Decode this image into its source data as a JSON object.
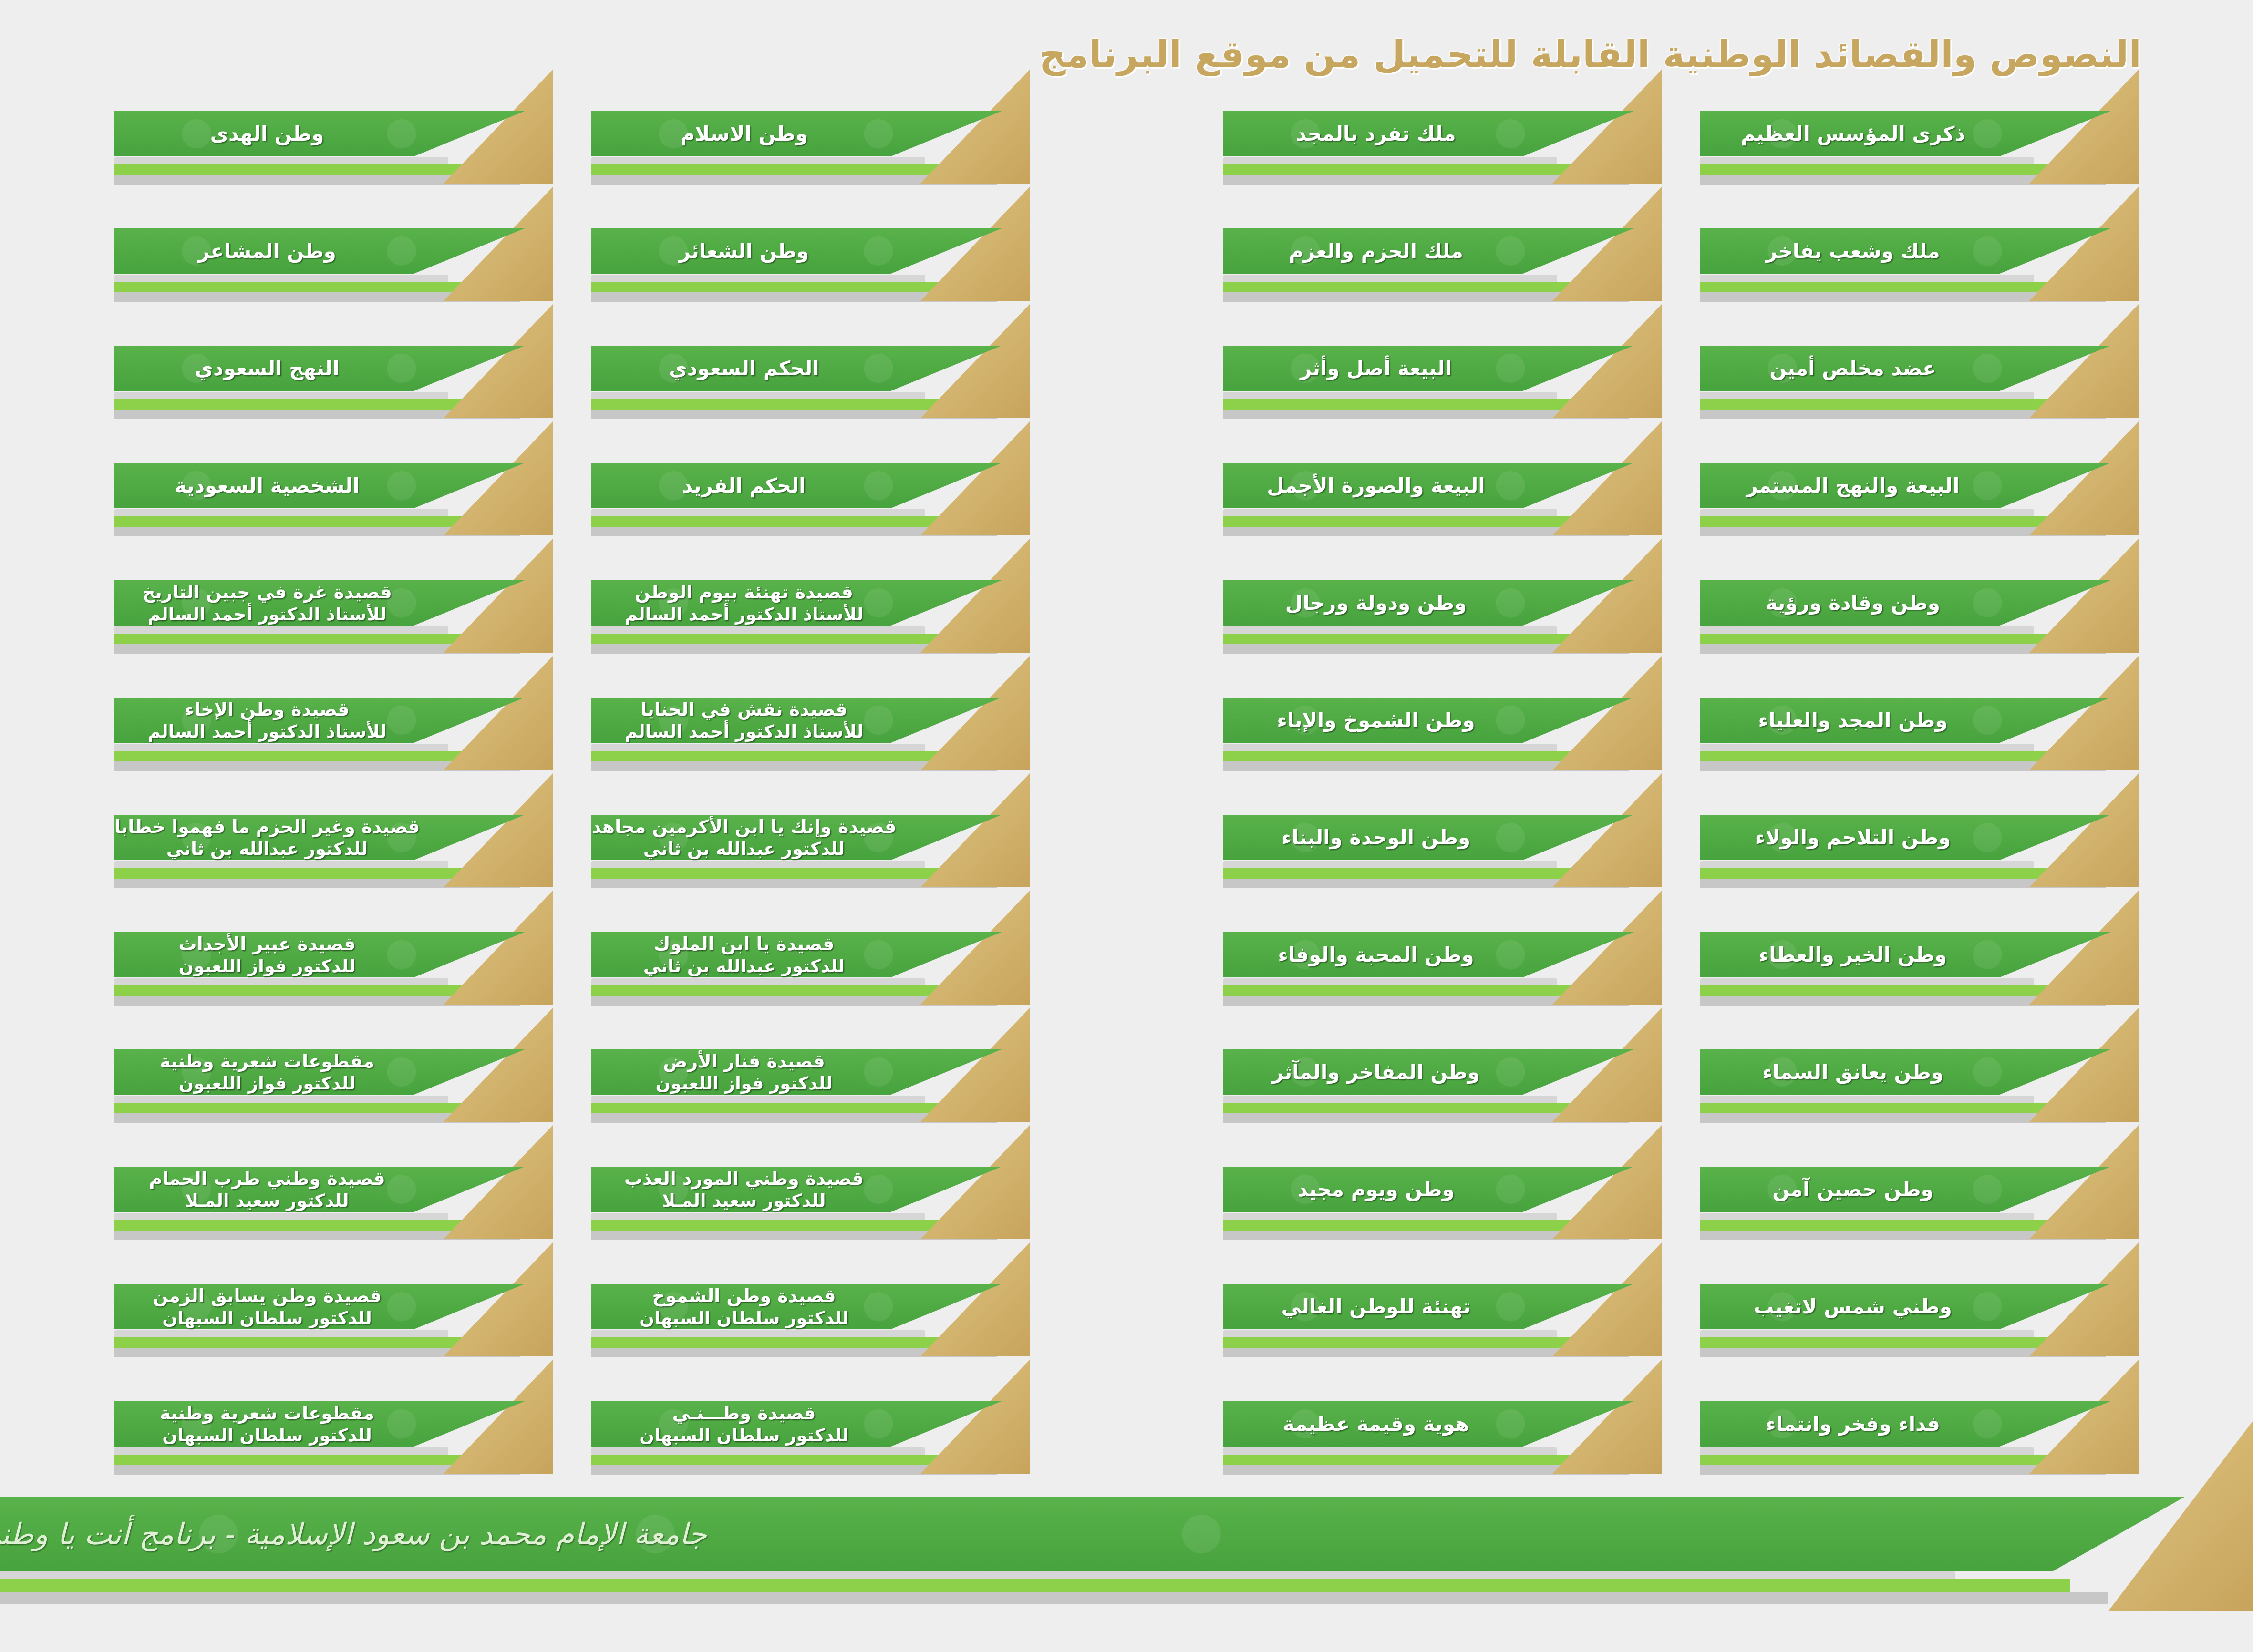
{
  "title": "النصوص والقصائد الوطنية القابلة للتحميل من موقع البرنامج",
  "colors": {
    "green": "#4caa41",
    "gold": "#d0b06a",
    "light_green": "#8dd14a",
    "grey": "#c7c7c7"
  },
  "columns": [
    {
      "items": [
        {
          "line1": "ذكرى المؤسس العظيم"
        },
        {
          "line1": "ملك وشعب يفاخر"
        },
        {
          "line1": "عضد مخلص أمين"
        },
        {
          "line1": "البيعة والنهج المستمر"
        },
        {
          "line1": "وطن وقادة ورؤية"
        },
        {
          "line1": "وطن المجد والعلياء"
        },
        {
          "line1": "وطن التلاحم والولاء"
        },
        {
          "line1": "وطن الخير والعطاء"
        },
        {
          "line1": "وطن يعانق السماء"
        },
        {
          "line1": "وطن حصين آمن"
        },
        {
          "line1": "وطني شمس لاتغيب"
        },
        {
          "line1": "فداء وفخر وانتماء"
        }
      ]
    },
    {
      "items": [
        {
          "line1": "ملك تفرد بالمجد"
        },
        {
          "line1": "ملك الحزم والعزم"
        },
        {
          "line1": "البيعة أصل وأثر"
        },
        {
          "line1": "البيعة والصورة الأجمل"
        },
        {
          "line1": "وطن ودولة ورجال"
        },
        {
          "line1": "وطن الشموخ والإباء"
        },
        {
          "line1": "وطن الوحدة والبناء"
        },
        {
          "line1": "وطن المحبة والوفاء"
        },
        {
          "line1": "وطن المفاخر والمآثر"
        },
        {
          "line1": "وطن ويوم مجيد"
        },
        {
          "line1": "تهنئة للوطن الغالي"
        },
        {
          "line1": "هوية وقيمة عظيمة"
        }
      ]
    },
    {
      "items": [
        {
          "line1": "وطن الاسلام"
        },
        {
          "line1": "وطن الشعائر"
        },
        {
          "line1": "الحكم السعودي"
        },
        {
          "line1": "الحكم الفريد"
        },
        {
          "line1": "قصيدة تهنئة بيوم الوطن",
          "line2": "للأستاذ الدكتور أحمد السالم"
        },
        {
          "line1": "قصيدة نقش في الحنايا",
          "line2": "للأستاذ الدكتور أحمد السالم"
        },
        {
          "line1": "قصيدة وإنك يا ابن الأكرمين مجاهد",
          "line2": "للدكتور عبدالله بن ثاني"
        },
        {
          "line1": "قصيدة يا ابن الملوك",
          "line2": "للدكتور عبدالله بن ثاني"
        },
        {
          "line1": "قصيدة فنار الأرض",
          "line2": "للدكتور فواز اللعبون"
        },
        {
          "line1": "قصيدة وطني المورد العذب",
          "line2": "للدكتور سعيد المـلا"
        },
        {
          "line1": "قصيدة وطن الشموخ",
          "line2": "للدكتور سلطان السبهان"
        },
        {
          "line1": "قصيدة وطـــنـي",
          "line2": "للدكتور سلطان السبهان"
        }
      ]
    },
    {
      "items": [
        {
          "line1": "وطن الهدى"
        },
        {
          "line1": "وطن المشاعر"
        },
        {
          "line1": "النهج السعودي"
        },
        {
          "line1": "الشخصية السعودية"
        },
        {
          "line1": "قصيدة غرة في جبين التاريخ",
          "line2": "للأستاذ الدكتور أحمد السالم"
        },
        {
          "line1": "قصيدة وطن الإخاء",
          "line2": "للأستاذ الدكتور أحمد السالم"
        },
        {
          "line1": "قصيدة وغير الحزم ما فهموا خطابا",
          "line2": "للدكتور عبدالله بن ثاني"
        },
        {
          "line1": "قصيدة عبير الأجداث",
          "line2": "للدكتور فواز اللعبون"
        },
        {
          "line1": "مقطوعات شعرية وطنية",
          "line2": "للدكتور فواز اللعبون"
        },
        {
          "line1": "قصيدة وطني طرب الحمام",
          "line2": "للدكتور سعيد المـلا"
        },
        {
          "line1": "قصيدة وطن يسابق الزمن",
          "line2": "للدكتور سلطان السبهان"
        },
        {
          "line1": "مقطوعات شعرية وطنية",
          "line2": "للدكتور سلطان السبهان"
        }
      ]
    }
  ],
  "footer": {
    "caption": "جامعة الإمام محمد بن سعود الإسلامية - برنامج أنت يا وطني أنا"
  }
}
